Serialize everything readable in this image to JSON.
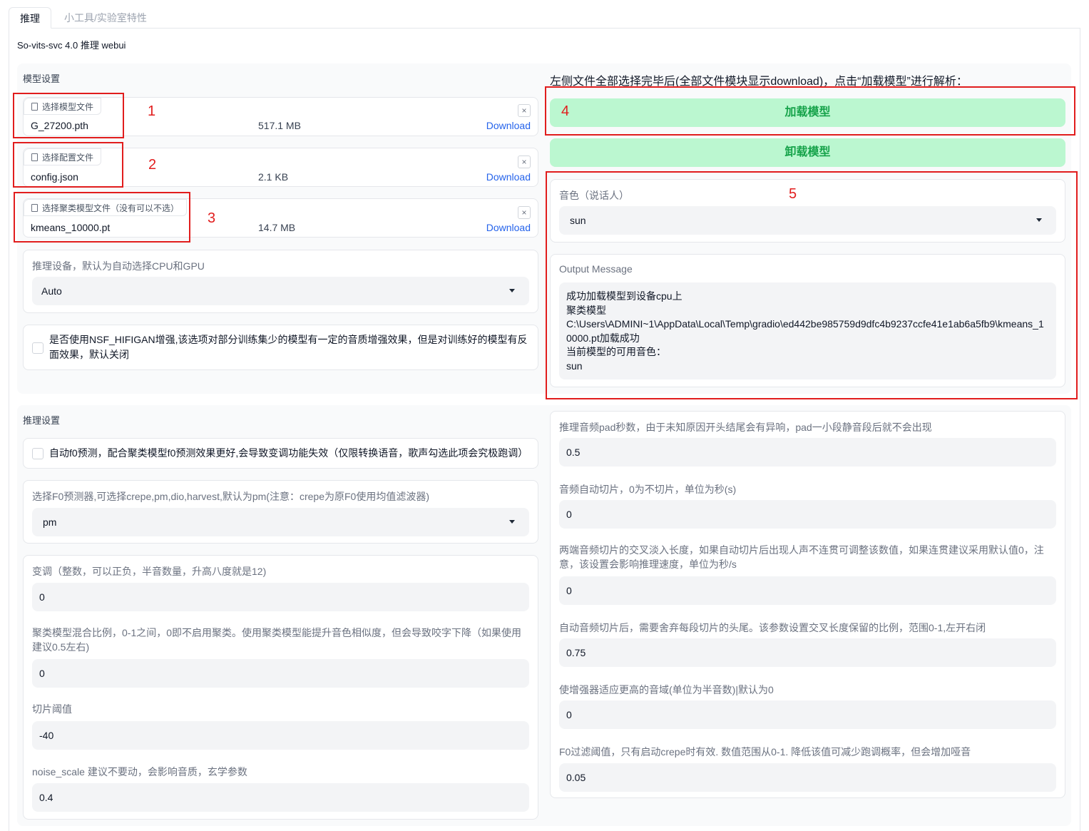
{
  "tabs": [
    {
      "label": "推理"
    },
    {
      "label": "小工具/实验室特性"
    }
  ],
  "app_title": "So-vits-svc 4.0 推理 webui",
  "model_settings": {
    "section_label": "模型设置",
    "model_file": {
      "button": "选择模型文件",
      "name": "G_27200.pth",
      "size": "517.1 MB",
      "download": "Download",
      "close": "×"
    },
    "config_file": {
      "button": "选择配置文件",
      "name": "config.json",
      "size": "2.1 KB",
      "download": "Download",
      "close": "×"
    },
    "cluster_file": {
      "button": "选择聚类模型文件（没有可以不选）",
      "name": "kmeans_10000.pt",
      "size": "14.7 MB",
      "download": "Download",
      "close": "×"
    },
    "device": {
      "label": "推理设备，默认为自动选择CPU和GPU",
      "value": "Auto"
    },
    "nsf": {
      "label": "是否使用NSF_HIFIGAN增强,该选项对部分训练集少的模型有一定的音质增强效果，但是对训练好的模型有反面效果，默认关闭"
    }
  },
  "right_panel": {
    "note": "左侧文件全部选择完毕后(全部文件模块显示download)，点击“加载模型”进行解析：",
    "load_button": "加载模型",
    "unload_button": "卸载模型",
    "speaker": {
      "label": "音色（说话人）",
      "value": "sun"
    },
    "output": {
      "label": "Output Message",
      "lines": [
        "成功加载模型到设备cpu上",
        "聚类模型",
        "C:\\Users\\ADMINI~1\\AppData\\Local\\Temp\\gradio\\ed442be985759d9dfc4b9237ccfe41e1ab6a5fb9\\kmeans_1",
        "0000.pt加载成功",
        "当前模型的可用音色：",
        "sun"
      ]
    }
  },
  "annotations": [
    "1",
    "2",
    "3",
    "4",
    "5"
  ],
  "annotation_color": "#e11d1d",
  "inference_settings": {
    "section_label": "推理设置",
    "auto_f0": {
      "label": "自动f0预测，配合聚类模型f0预测效果更好,会导致变调功能失效（仅限转换语音，歌声勾选此项会究极跑调）"
    },
    "f0_predictor": {
      "label": "选择F0预测器,可选择crepe,pm,dio,harvest,默认为pm(注意：crepe为原F0使用均值滤波器)",
      "value": "pm"
    },
    "transpose": {
      "label": "变调（整数，可以正负，半音数量，升高八度就是12)",
      "value": "0"
    },
    "cluster_ratio": {
      "label": "聚类模型混合比例，0-1之间，0即不启用聚类。使用聚类模型能提升音色相似度，但会导致咬字下降（如果使用建议0.5左右)",
      "value": "0"
    },
    "slice_db": {
      "label": "切片阈值",
      "value": "-40"
    },
    "noise_scale": {
      "label": "noise_scale 建议不要动，会影响音质，玄学参数",
      "value": "0.4"
    },
    "pad_seconds": {
      "label": "推理音频pad秒数，由于未知原因开头结尾会有异响，pad一小段静音段后就不会出现",
      "value": "0.5"
    },
    "auto_slice": {
      "label": "音频自动切片，0为不切片，单位为秒(s)",
      "value": "0"
    },
    "crossfade": {
      "label": "两端音频切片的交叉淡入长度，如果自动切片后出现人声不连贯可调整该数值，如果连贯建议采用默认值0，注意，该设置会影响推理速度，单位为秒/s",
      "value": "0"
    },
    "clip_ratio": {
      "label": "自动音频切片后，需要舍弃每段切片的头尾。该参数设置交叉长度保留的比例，范围0-1,左开右闭",
      "value": "0.75"
    },
    "enhancer_adaptive": {
      "label": "使增强器适应更高的音域(单位为半音数)|默认为0",
      "value": "0"
    },
    "f0_filter": {
      "label": "F0过滤阈值，只有启动crepe时有效. 数值范围从0-1. 降低该值可减少跑调概率，但会增加哑音",
      "value": "0.05"
    }
  }
}
